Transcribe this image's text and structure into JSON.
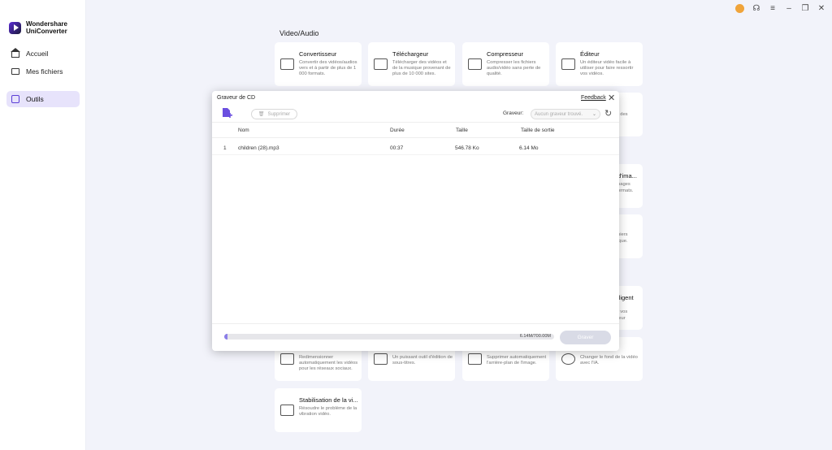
{
  "app": {
    "name_line1": "Wondershare",
    "name_line2": "UniConverter"
  },
  "sidebar": {
    "items": [
      {
        "label": "Accueil",
        "icon": "home-icon"
      },
      {
        "label": "Mes fichiers",
        "icon": "folder-icon"
      },
      {
        "label": "Outils",
        "icon": "tools-icon",
        "active": true
      }
    ]
  },
  "window": {
    "minimize": "–",
    "maximize": "❐",
    "close": "✕",
    "menu": "≡",
    "support": "☊"
  },
  "tools": {
    "section_title": "Video/Audio",
    "cards": [
      {
        "title": "Convertisseur",
        "desc": "Convertir des vidéos/audios vers et à partir de plus de 1 000 formats."
      },
      {
        "title": "Téléchargeur",
        "desc": "Télécharger des vidéos et de la musique provenant de plus de 10 000 sites."
      },
      {
        "title": "Compresseur",
        "desc": "Compresser les fichiers audio/vidéo sans perte de qualité."
      },
      {
        "title": "Éditeur",
        "desc": "Un éditeur vidéo facile à utiliser pour faire ressortir vos vidéos."
      },
      {
        "title": "",
        "desc": "Redimensionner automatiquement les vidéos pour les réseaux sociaux."
      },
      {
        "title": "",
        "desc": "Un puissant outil d'édition de sous-titres."
      },
      {
        "title": "",
        "desc": "Supprimer automatiquement l'arrière-plan de l'image."
      },
      {
        "title": "",
        "desc": "Changer le fond de la vidéo avec l'IA."
      },
      {
        "title": "Stabilisation de la vi...",
        "desc": "Résoudre le problème de la vibration vidéo."
      }
    ],
    "partial_right": [
      {
        "text": "t des"
      },
      {
        "text": "d'ima..."
      },
      {
        "text": "nages"
      },
      {
        "text": "ormats."
      },
      {
        "text": "hiers"
      },
      {
        "text": "ique."
      },
      {
        "text": "lligent"
      },
      {
        "text": "t vos"
      },
      {
        "text": "leur"
      }
    ]
  },
  "dialog": {
    "title": "Graveur de CD",
    "feedback": "Feedback",
    "close": "✕",
    "delete_label": "Supprimer",
    "burner_label": "Graveur:",
    "burner_value": "Aucun graveur trouvé.",
    "columns": {
      "name": "Nom",
      "duration": "Durée",
      "size": "Taille",
      "output_size": "Taille de sortie"
    },
    "rows": [
      {
        "index": "1",
        "name": "children  (28).mp3",
        "duration": "00:37",
        "size": "546.78 Ko",
        "output_size": "6.14 Mo"
      }
    ],
    "progress_text": "6.14M/700.00M",
    "progress_fraction": 0.009,
    "burn_label": "Graver"
  },
  "colors": {
    "accent": "#5b3ed6",
    "progress": "#8b7ee8",
    "background": "#f2f3fa"
  }
}
